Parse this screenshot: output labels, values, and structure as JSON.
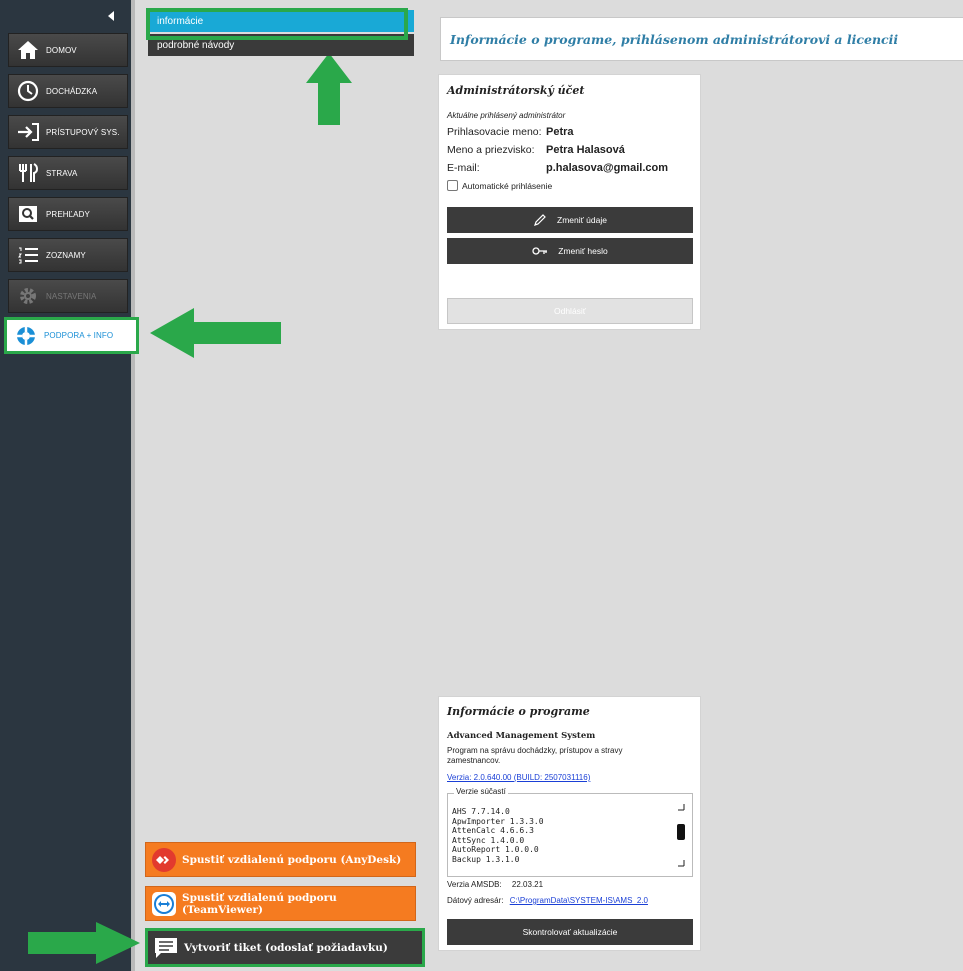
{
  "sidebar": {
    "items": [
      {
        "label": "DOMOV",
        "icon": "home-icon"
      },
      {
        "label": "DOCHÁDZKA",
        "icon": "clock-icon"
      },
      {
        "label": "PRÍSTUPOVÝ SYS.",
        "icon": "login-arrow-icon"
      },
      {
        "label": "STRAVA",
        "icon": "cutlery-icon"
      },
      {
        "label": "PREHĽADY",
        "icon": "magnifier-icon"
      },
      {
        "label": "ZOZNAMY",
        "icon": "list-icon"
      },
      {
        "label": "NASTAVENIA",
        "icon": "gear-icon"
      },
      {
        "label": "PODPORA + INFO",
        "icon": "lifebuoy-icon"
      }
    ]
  },
  "tree": {
    "items": [
      "informácie",
      "podrobné návody"
    ]
  },
  "header": {
    "title": "Informácie o programe, prihlásenom administrátorovi a licencii"
  },
  "admin": {
    "title": "Administrátorský účet",
    "subtitle": "Aktuálne prihlásený administrátor",
    "login_label": "Prihlasovacie meno:",
    "login_value": "Petra",
    "name_label": "Meno a priezvisko:",
    "name_value": "Petra Halasová",
    "email_label": "E-mail:",
    "email_value": "p.halasova@gmail.com",
    "auto_login": "Automatické prihlásenie",
    "btn_change_data": "Zmeniť údaje",
    "btn_change_password": "Zmeniť heslo",
    "btn_logout": "Odhlásiť"
  },
  "info": {
    "title": "Informácie o programe",
    "product": "Advanced Management System",
    "desc": "Program na správu dochádzky, prístupov a stravy zamestnancov.",
    "version_link": "Verzia: 2.0.640.00 (BUILD: 2507031116)",
    "components_legend": "Verzie súčastí",
    "components": [
      "AHS 7.7.14.0",
      "ApwImporter 1.3.3.0",
      "AttenCalc 4.6.6.3",
      "AttSync 1.4.0.0",
      "AutoReport 1.0.0.0",
      "Backup 1.3.1.0"
    ],
    "amsdb_label": "Verzia AMSDB:",
    "amsdb_value": "22.03.21",
    "data_dir_label": "Dátový adresár:",
    "data_dir_value": "C:\\ProgramData\\SYSTEM-IS\\AMS_2.0",
    "btn_check_updates": "Skontrolovať aktualizácie"
  },
  "support": {
    "anydesk": "Spustiť vzdialenú podporu (AnyDesk)",
    "teamviewer": "Spustiť vzdialenú podporu (TeamViewer)",
    "ticket": "Vytvoriť tiket (odoslať požiadavku)"
  },
  "colors": {
    "accent": "#19a9d6",
    "highlight": "#2aa84a",
    "orange": "#f57b20"
  }
}
